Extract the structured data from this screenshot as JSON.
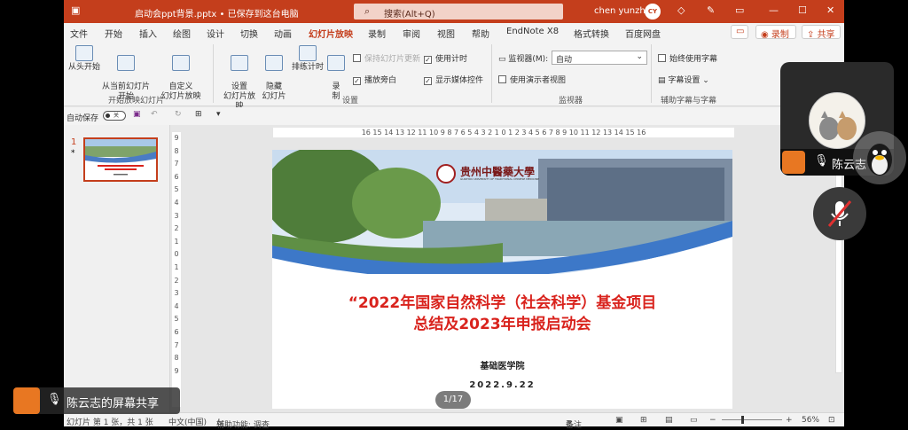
{
  "window": {
    "doc_title": "启动会ppt背景.pptx • 已保存到这台电脑",
    "search_placeholder": "搜索(Alt+Q)",
    "user_name": "chen yunzhi",
    "user_initials": "CY"
  },
  "tabs": [
    "文件",
    "开始",
    "插入",
    "绘图",
    "设计",
    "切换",
    "动画",
    "幻灯片放映",
    "录制",
    "审阅",
    "视图",
    "帮助",
    "EndNote X8",
    "格式转换",
    "百度网盘"
  ],
  "active_tab": "幻灯片放映",
  "right_buttons": {
    "record": "录制",
    "share": "共享"
  },
  "ribbon": {
    "start_group": {
      "from_start": "从头开始",
      "from_current": "从当前幻灯片\n开始",
      "custom": "自定义\n幻灯片放映",
      "label": "开始放映幻灯片"
    },
    "setup_group": {
      "setup": "设置\n幻灯片放映",
      "hide": "隐藏\n幻灯片",
      "rehearse": "排练计时",
      "record": "录\n制",
      "label": "设置"
    },
    "checkboxes": {
      "keep_updated": "保持幻灯片更新",
      "use_timings": "使用计时",
      "play_narrations": "播放旁白",
      "show_media": "显示媒体控件"
    },
    "monitor_group": {
      "monitor_label": "监视器(M):",
      "monitor_value": "自动",
      "presenter_view": "使用演示者视图",
      "label": "监视器"
    },
    "caption_group": {
      "always_caption": "始终使用字幕",
      "caption_settings": "字幕设置",
      "label": "辅助字幕与字幕"
    }
  },
  "qat": {
    "autosave_label": "自动保存",
    "toggle": "关"
  },
  "thumbnail": {
    "number": "1",
    "star": "*"
  },
  "rulers": {
    "horizontal": "16 15 14 13 12 11 10 9 8 7 6 5 4 3 2 1 0 1 2 3 4 5 6 7 8 9 10 11 12 13 14 15 16",
    "vertical": [
      "9",
      "8",
      "7",
      "6",
      "5",
      "4",
      "3",
      "2",
      "1",
      "0",
      "1",
      "2",
      "3",
      "4",
      "5",
      "6",
      "7",
      "8",
      "9"
    ]
  },
  "slide": {
    "university": "贵州中醫藥大學",
    "university_en": "GUIZHOU UNIVERSITY OF TRADITIONAL CHINESE MEDICINE",
    "title_line1": "“2022年国家自然科学（社会科学）基金项目",
    "title_line2": "总结及2023年申报启动会",
    "department": "基础医学院",
    "date": "2022.9.22"
  },
  "page_badge": "1/17",
  "status": {
    "slide_info": "幻灯片 第 1 张，共 1 张",
    "language": "中文(中国)",
    "accessibility": "辅助功能: 调查",
    "notes": "备注",
    "zoom": "56%"
  },
  "meeting": {
    "participant_name": "陈云志",
    "share_label": "陈云志的屏幕共享"
  },
  "colors": {
    "accent": "#c43e1c",
    "title_red": "#d9231d",
    "avatar_orange": "#e87722"
  }
}
